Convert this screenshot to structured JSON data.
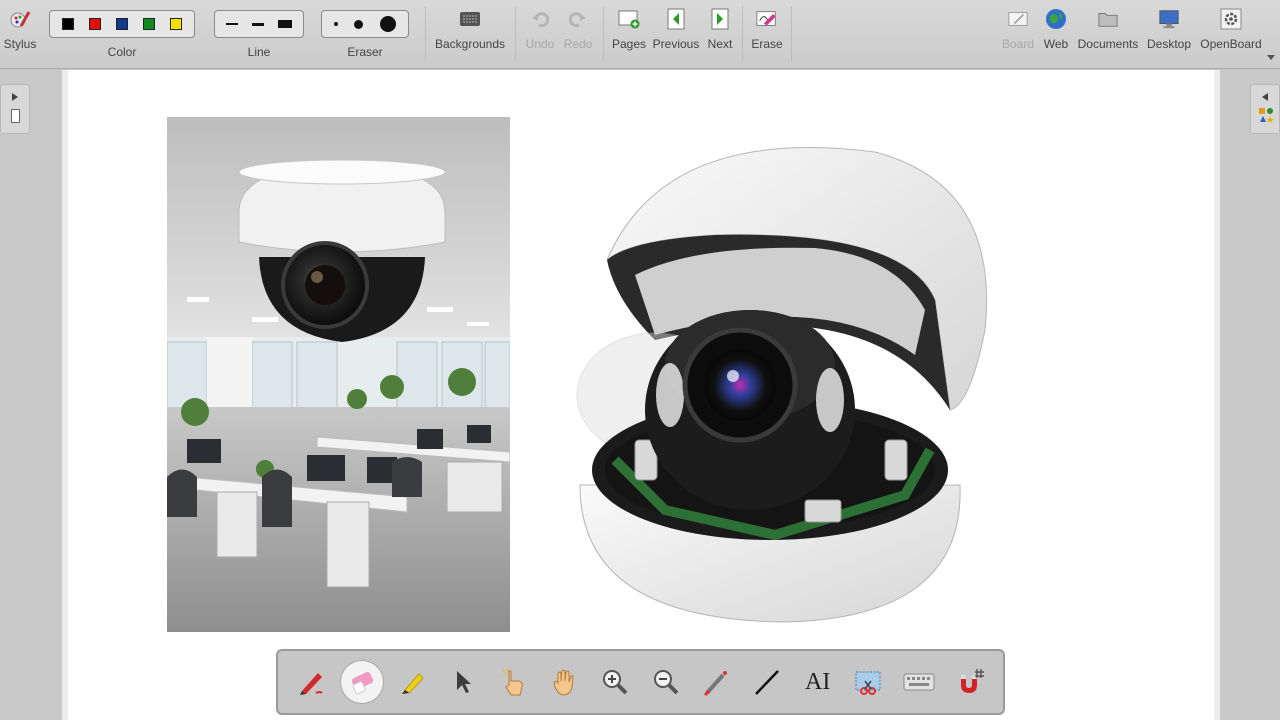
{
  "toolbar": {
    "stylus_label": "Stylus",
    "color_label": "Color",
    "line_label": "Line",
    "eraser_label": "Eraser",
    "backgrounds_label": "Backgrounds",
    "undo_label": "Undo",
    "redo_label": "Redo",
    "pages_label": "Pages",
    "previous_label": "Previous",
    "next_label": "Next",
    "erase_label": "Erase",
    "board_label": "Board",
    "web_label": "Web",
    "documents_label": "Documents",
    "desktop_label": "Desktop",
    "openboard_label": "OpenBoard",
    "colors": [
      "#000000",
      "#e01010",
      "#103a8c",
      "#0f8a1e",
      "#f2e000"
    ]
  },
  "palette": {
    "tools": [
      {
        "name": "pen-tool",
        "active": false
      },
      {
        "name": "eraser-tool",
        "active": true
      },
      {
        "name": "highlighter-tool",
        "active": false
      },
      {
        "name": "selector-tool",
        "active": false
      },
      {
        "name": "interactive-pointer-tool",
        "active": false
      },
      {
        "name": "hand-pan-tool",
        "active": false
      },
      {
        "name": "zoom-in-tool",
        "active": false
      },
      {
        "name": "zoom-out-tool",
        "active": false
      },
      {
        "name": "laser-pointer-tool",
        "active": false
      },
      {
        "name": "line-tool",
        "active": false
      },
      {
        "name": "text-tool",
        "active": false
      },
      {
        "name": "capture-tool",
        "active": false
      },
      {
        "name": "virtual-keyboard-tool",
        "active": false
      },
      {
        "name": "magnet-tool",
        "active": false
      }
    ],
    "text_tool_glyph": "AI"
  }
}
